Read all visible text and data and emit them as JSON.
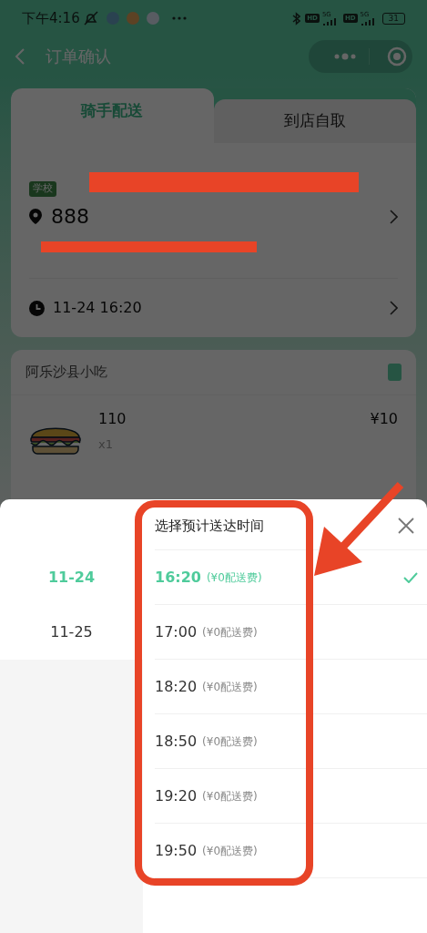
{
  "status_bar": {
    "time": "下午4:16",
    "sims": [
      {
        "hd": "HD",
        "network": "5G"
      },
      {
        "hd": "HD",
        "network": "5G"
      }
    ],
    "battery": "31"
  },
  "nav": {
    "title": "订单确认"
  },
  "delivery_tabs": [
    {
      "label": "骑手配送",
      "selected": true
    },
    {
      "label": "到店自取",
      "selected": false
    }
  ],
  "address": {
    "tag": "学校",
    "name": "888"
  },
  "schedule": {
    "time": "11-24 16:20"
  },
  "shop": {
    "name": "阿乐沙县小吃",
    "items": [
      {
        "name": "110",
        "quantity": "x1",
        "price": "¥10"
      }
    ]
  },
  "time_picker": {
    "title": "选择预计送达时间",
    "dates": [
      {
        "label": "11-24",
        "selected": true
      },
      {
        "label": "11-25",
        "selected": false
      }
    ],
    "slots": [
      {
        "time": "16:20",
        "fee": "(¥0配送费)",
        "selected": true
      },
      {
        "time": "17:00",
        "fee": "(¥0配送费)",
        "selected": false
      },
      {
        "time": "18:20",
        "fee": "(¥0配送费)",
        "selected": false
      },
      {
        "time": "18:50",
        "fee": "(¥0配送费)",
        "selected": false
      },
      {
        "time": "19:20",
        "fee": "(¥0配送费)",
        "selected": false
      },
      {
        "time": "19:50",
        "fee": "(¥0配送费)",
        "selected": false
      }
    ]
  }
}
